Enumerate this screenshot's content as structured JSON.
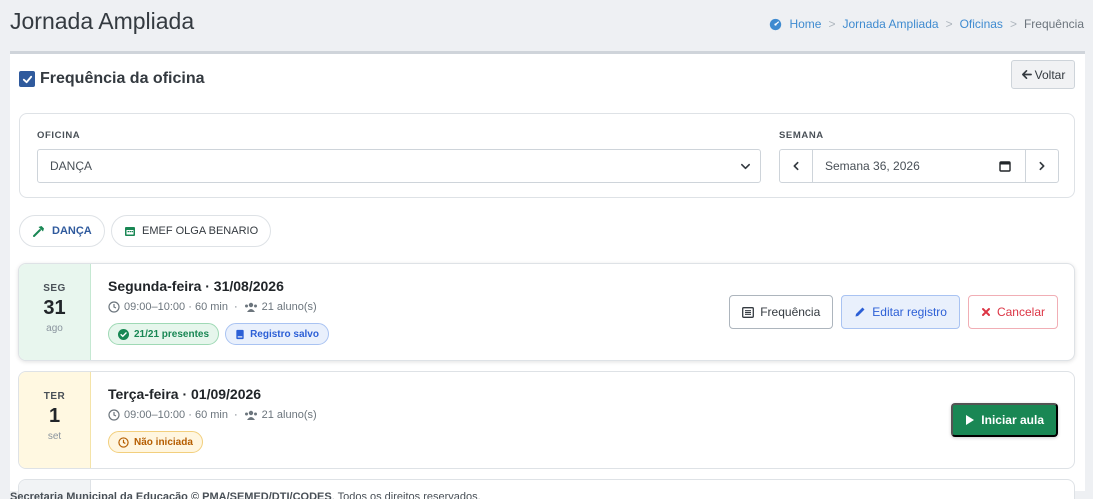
{
  "page": {
    "title": "Jornada Ampliada"
  },
  "breadcrumb": {
    "home": "Home",
    "item2": "Jornada Ampliada",
    "item3": "Oficinas",
    "current": "Frequência",
    "separator": ">"
  },
  "card": {
    "title": "Frequência da oficina",
    "back_label": "Voltar"
  },
  "filters": {
    "oficina_label": "OFICINA",
    "oficina_value": "DANÇA",
    "semana_label": "SEMANA",
    "semana_value": "Semana 36, 2026"
  },
  "chips": {
    "oficina": "DANÇA",
    "escola": "EMEF OLGA BENARIO"
  },
  "days": [
    {
      "dow": "SEG",
      "day": "31",
      "month": "ago",
      "title": "Segunda-feira · 31/08/2026",
      "time": "09:00–10:00 · 60 min",
      "students": "21 aluno(s)",
      "badge_presentes": "21/21 presentes",
      "badge_registro": "Registro salvo",
      "btn_frequencia": "Frequência",
      "btn_editar": "Editar registro",
      "btn_cancelar": "Cancelar"
    },
    {
      "dow": "TER",
      "day": "1",
      "month": "set",
      "title": "Terça-feira · 01/09/2026",
      "time": "09:00–10:00 · 60 min",
      "students": "21 aluno(s)",
      "badge_status": "Não iniciada",
      "btn_iniciar": "Iniciar aula"
    }
  ],
  "footer": {
    "org": "Secretaria Municipal da Educação © PMA/SEMED/DTI/CODES",
    "rights": ". Todos os direitos reservados."
  },
  "colors": {
    "accent": "#2f5a9d",
    "success": "#198754",
    "danger": "#dc3545",
    "link": "#3f8bd0"
  },
  "icons": [
    "gauge-icon",
    "checkbox-icon",
    "arrow-left-icon",
    "chevron-down-icon",
    "chevron-left-icon",
    "chevron-right-icon",
    "calendar-icon",
    "hammer-icon",
    "clock-icon",
    "users-icon",
    "check-circle-icon",
    "book-icon",
    "list-icon",
    "pencil-icon",
    "x-icon",
    "play-icon"
  ]
}
